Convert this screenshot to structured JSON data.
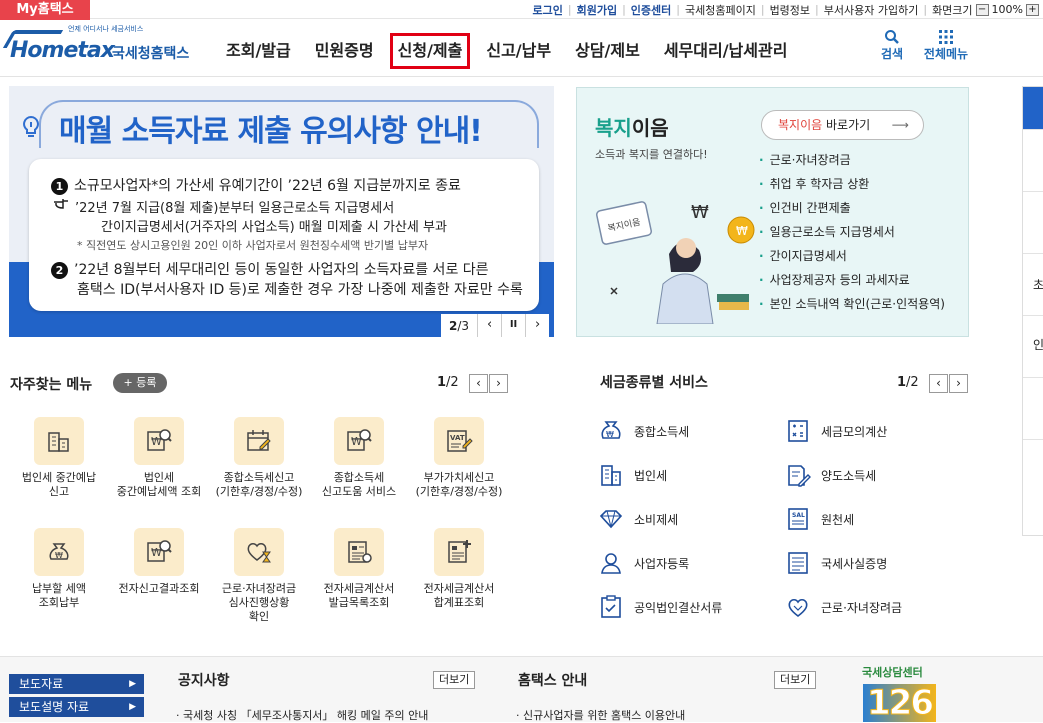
{
  "topbar": {
    "my_hometax": "My홈택스",
    "links": [
      "로그인",
      "회원가입",
      "인증센터",
      "국세청홈페이지",
      "법령정보",
      "부서사용자 가입하기",
      "화면크기"
    ],
    "zoom_minus": "−",
    "zoom_level": "100%",
    "zoom_plus": "+"
  },
  "header": {
    "logo_small": "언제 어디서나 세금서비스",
    "logo_main": "Hometax",
    "logo_kr": "국세청홈택스",
    "nav": [
      "조회/발급",
      "민원증명",
      "신청/제출",
      "신고/납부",
      "상담/제보",
      "세무대리/납세관리"
    ],
    "search_label": "검색",
    "menu_label": "전체메뉴"
  },
  "banner": {
    "title": "매월 소득자료 제출 유의사항 안내!",
    "item1_num": "1",
    "item1": "소규모사업자*의 가산세 유예기간이 ’22년 6월 지급분까지로 종료",
    "item1_sub1": "’22년 7월 지급(8월 제출)분부터 일용근로소득 지급명세서",
    "item1_sub2": "간이지급명세서(거주자의 사업소득) 매월 미제출 시 가산세 부과",
    "item1_note": "* 직전연도 상시고용인원 20인 이하 사업자로서 원천징수세액 반기별 납부자",
    "item2_num": "2",
    "item2_line1": "’22년 8월부터 세무대리인 등이 동일한 사업자의 소득자료를 서로 다른",
    "item2_line2": "홈택스 ID(부서사용자 ID 등)로 제출한 경우 가장 나중에 제출한 자료만 수록",
    "page_current": "2",
    "page_total": "/3",
    "prev": "‹",
    "pause": "II",
    "next": "›"
  },
  "welfare": {
    "title_green": "복지",
    "title_rest": "이음",
    "subtitle": "소득과 복지를 연결하다!",
    "button_red": "복지이음",
    "button_rest": " 바로가기",
    "items": [
      "근로·자녀장려금",
      "취업 후 학자금 상환",
      "인건비 간편제출",
      "일용근로소득 지급명세서",
      "간이지급명세서",
      "사업장제공자 등의 과세자료",
      "본인 소득내역 확인(근로·인적용역)"
    ],
    "illus_text": "복지이음"
  },
  "rail": {
    "labels": [
      "",
      "",
      "초",
      "",
      "인",
      "",
      ""
    ]
  },
  "quick_menu": {
    "title": "자주찾는 메뉴",
    "register": "+ 등록",
    "page_current": "1",
    "page_total": "/2",
    "items": [
      {
        "label": "법인세 중간예납\n신고",
        "icon": "building-icon"
      },
      {
        "label": "법인세\n중간예납세액 조회",
        "icon": "won-doc-search-icon"
      },
      {
        "label": "종합소득세신고\n(기한후/경정/수정)",
        "icon": "calendar-pen-icon"
      },
      {
        "label": "종합소득세\n신고도움 서비스",
        "icon": "won-doc-search-icon"
      },
      {
        "label": "부가가치세신고\n(기한후/경정/수정)",
        "icon": "vat-doc-icon"
      },
      {
        "label": "납부할 세액\n조회납부",
        "icon": "money-bag-icon"
      },
      {
        "label": "전자신고결과조회",
        "icon": "won-doc-search-icon"
      },
      {
        "label": "근로·자녀장려금\n심사진행상황\n확인",
        "icon": "heart-hourglass-icon"
      },
      {
        "label": "전자세금계산서\n발급목록조회",
        "icon": "invoice-list-icon"
      },
      {
        "label": "전자세금계산서\n합계표조회",
        "icon": "invoice-plus-icon"
      }
    ]
  },
  "tax_service": {
    "title": "세금종류별 서비스",
    "page_current": "1",
    "page_total": "/2",
    "items": [
      {
        "label": "종합소득세",
        "icon": "money-bag-icon"
      },
      {
        "label": "세금모의계산",
        "icon": "calculator-icon"
      },
      {
        "label": "법인세",
        "icon": "building-icon"
      },
      {
        "label": "양도소득세",
        "icon": "doc-pen-icon"
      },
      {
        "label": "소비제세",
        "icon": "diamond-icon"
      },
      {
        "label": "원천세",
        "icon": "salary-doc-icon"
      },
      {
        "label": "사업자등록",
        "icon": "person-icon"
      },
      {
        "label": "국세사실증명",
        "icon": "doc-list-icon"
      },
      {
        "label": "공익법인결산서류",
        "icon": "clipboard-check-icon"
      },
      {
        "label": "근로·자녀장려금",
        "icon": "heart-hands-icon"
      }
    ]
  },
  "bottom": {
    "press": [
      "보도자료",
      "보도설명 자료"
    ],
    "notice_title": "공지사항",
    "notice_more": "더보기",
    "notice_first": "국세청 사칭 「세무조사통지서」 해킹 메일 주의 안내",
    "guide_title": "홈택스 안내",
    "guide_more": "더보기",
    "guide_first": "신규사업자를 위한 홈택스 이용안내",
    "center_label": "국세상담센터",
    "center_number": "126"
  },
  "colors": {
    "brand_blue": "#2163c8",
    "alert_red": "#e8434b",
    "welfare_green": "#19a08c",
    "icon_bg": "#fbeccb"
  }
}
